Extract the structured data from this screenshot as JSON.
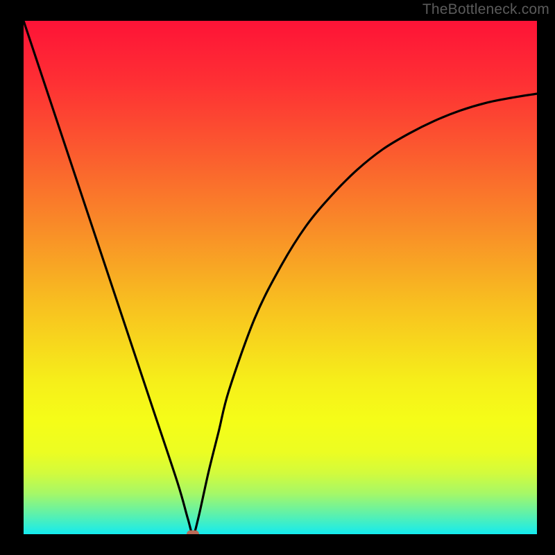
{
  "watermark": "TheBottleneck.com",
  "chart_data": {
    "type": "line",
    "title": "",
    "xlabel": "",
    "ylabel": "",
    "xlim": [
      0,
      100
    ],
    "ylim": [
      0,
      100
    ],
    "series": [
      {
        "name": "bottleneck-curve",
        "x": [
          0,
          5,
          10,
          15,
          20,
          25,
          30,
          32,
          33,
          34,
          36,
          38,
          40,
          45,
          50,
          55,
          60,
          65,
          70,
          75,
          80,
          85,
          90,
          95,
          100
        ],
        "y": [
          100,
          85,
          70,
          55,
          40,
          25,
          10,
          3,
          0,
          3,
          12,
          20,
          28,
          42,
          52,
          60,
          66,
          71,
          75,
          78,
          80.5,
          82.5,
          84,
          85,
          85.8
        ]
      }
    ],
    "marker": {
      "x": 33,
      "y": 0
    },
    "background_gradient": {
      "stops": [
        {
          "pos": 0.0,
          "color": "#fe1337"
        },
        {
          "pos": 0.12,
          "color": "#fe3034"
        },
        {
          "pos": 0.25,
          "color": "#fb592f"
        },
        {
          "pos": 0.4,
          "color": "#f98b28"
        },
        {
          "pos": 0.55,
          "color": "#f8bf20"
        },
        {
          "pos": 0.7,
          "color": "#f6ee1a"
        },
        {
          "pos": 0.78,
          "color": "#f5fd18"
        },
        {
          "pos": 0.84,
          "color": "#ecfd22"
        },
        {
          "pos": 0.88,
          "color": "#d3fb3c"
        },
        {
          "pos": 0.92,
          "color": "#a7f866"
        },
        {
          "pos": 0.96,
          "color": "#5ff1aa"
        },
        {
          "pos": 1.0,
          "color": "#14ebf0"
        }
      ]
    }
  }
}
